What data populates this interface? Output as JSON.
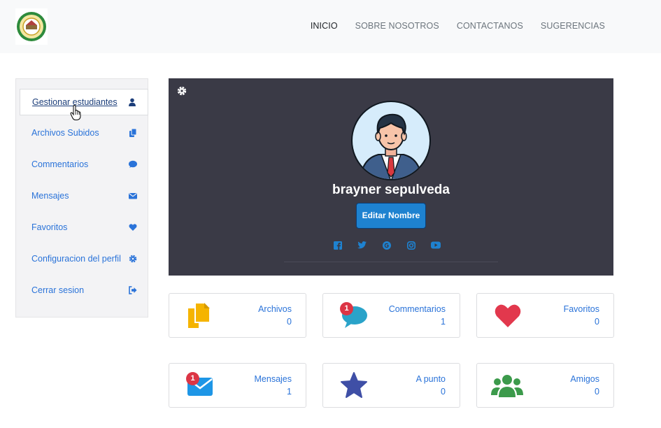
{
  "header": {
    "logo_alt": "logo",
    "nav": [
      {
        "label": "INICIO",
        "active": true
      },
      {
        "label": "SOBRE NOSOTROS",
        "active": false
      },
      {
        "label": "CONTACTANOS",
        "active": false
      },
      {
        "label": "SUGERENCIAS",
        "active": false
      }
    ]
  },
  "sidebar": {
    "items": [
      {
        "label": "Gestionar estudiantes",
        "icon": "user-icon",
        "active": true
      },
      {
        "label": "Archivos Subidos",
        "icon": "files-icon",
        "active": false
      },
      {
        "label": "Commentarios",
        "icon": "comment-icon",
        "active": false
      },
      {
        "label": "Mensajes",
        "icon": "envelope-icon",
        "active": false
      },
      {
        "label": "Favoritos",
        "icon": "heart-icon",
        "active": false
      },
      {
        "label": "Configuracion del perfil",
        "icon": "gear-icon",
        "active": false
      },
      {
        "label": "Cerrar sesion",
        "icon": "sign-out-icon",
        "active": false
      }
    ]
  },
  "profile": {
    "name": "brayner sepulveda",
    "edit_button": "Editar Nombre",
    "socials": [
      "facebook-icon",
      "twitter-icon",
      "google-icon",
      "instagram-icon",
      "youtube-icon"
    ]
  },
  "stats": [
    {
      "label": "Archivos",
      "value": "0",
      "icon": "files-icon",
      "color": "#f5b400",
      "badge": ""
    },
    {
      "label": "Commentarios",
      "value": "1",
      "icon": "comment-icon",
      "color": "#2aa3c9",
      "badge": "1"
    },
    {
      "label": "Favoritos",
      "value": "0",
      "icon": "heart-icon",
      "color": "#e2384d",
      "badge": ""
    },
    {
      "label": "Mensajes",
      "value": "1",
      "icon": "envelope-icon",
      "color": "#1e96e6",
      "badge": "1"
    },
    {
      "label": "A punto",
      "value": "0",
      "icon": "star-icon",
      "color": "#3f4fa6",
      "badge": ""
    },
    {
      "label": "Amigos",
      "value": "0",
      "icon": "users-icon",
      "color": "#3c9a4b",
      "badge": ""
    }
  ],
  "colors": {
    "accent": "#2a73d9",
    "profile_bg": "#3a3a46",
    "button": "#1e82d0",
    "badge": "#dc3545"
  }
}
